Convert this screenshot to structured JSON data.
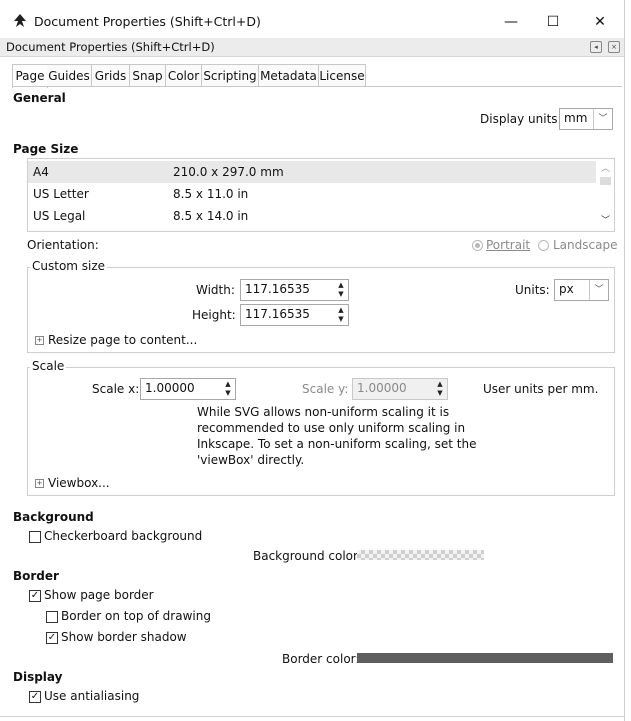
{
  "window": {
    "title": "Document Properties (Shift+Ctrl+D)",
    "dock_title": "Document Properties (Shift+Ctrl+D)",
    "controls": {
      "minimize": "—",
      "maximize": "☐",
      "close": "✕"
    }
  },
  "tabs": [
    "Page",
    "Guides",
    "Grids",
    "Snap",
    "Color",
    "Scripting",
    "Metadata",
    "License"
  ],
  "active_tab": "Page",
  "general": {
    "heading": "General",
    "display_units_label": "Display units:",
    "display_units_value": "mm"
  },
  "page_size": {
    "heading": "Page Size",
    "rows": [
      {
        "name": "A4",
        "size": "210.0 x 297.0 mm"
      },
      {
        "name": "US Letter",
        "size": "8.5 x 11.0 in"
      },
      {
        "name": "US Legal",
        "size": "8.5 x 14.0 in"
      }
    ],
    "selected": "A4",
    "orientation_label": "Orientation:",
    "portrait": "Portrait",
    "landscape": "Landscape"
  },
  "custom_size": {
    "legend": "Custom size",
    "width_label": "Width:",
    "width_value": "117.16535",
    "height_label": "Height:",
    "height_value": "117.16535",
    "units_label": "Units:",
    "units_value": "px",
    "resize_label": "Resize page to content..."
  },
  "scale": {
    "legend": "Scale",
    "scale_x_label": "Scale x:",
    "scale_x_value": "1.00000",
    "scale_y_label": "Scale y:",
    "scale_y_value": "1.00000",
    "units_note": "User units per mm.",
    "note_lines": [
      "While SVG allows non-uniform scaling it is",
      "recommended to use only uniform scaling in",
      "Inkscape. To set a non-uniform scaling, set the",
      "'viewBox' directly."
    ],
    "viewbox_label": "Viewbox..."
  },
  "background": {
    "heading": "Background",
    "checkerboard_label": "Checkerboard background",
    "checkerboard_checked": false,
    "color_label": "Background color:"
  },
  "border": {
    "heading": "Border",
    "show_border_label": "Show page border",
    "show_border_checked": true,
    "on_top_label": "Border on top of drawing",
    "on_top_checked": false,
    "shadow_label": "Show border shadow",
    "shadow_checked": true,
    "color_label": "Border color:",
    "color": "#5f5f5f"
  },
  "display": {
    "heading": "Display",
    "antialias_label": "Use antialiasing",
    "antialias_checked": true
  },
  "icons": {
    "app": "inkscape-logo-icon",
    "scroll_up": "chevron-up-icon",
    "scroll_down": "chevron-down-icon",
    "combo_arrow": "chevron-down-icon",
    "spin": "spin-arrows-icon",
    "expander": "plus-square-icon"
  }
}
